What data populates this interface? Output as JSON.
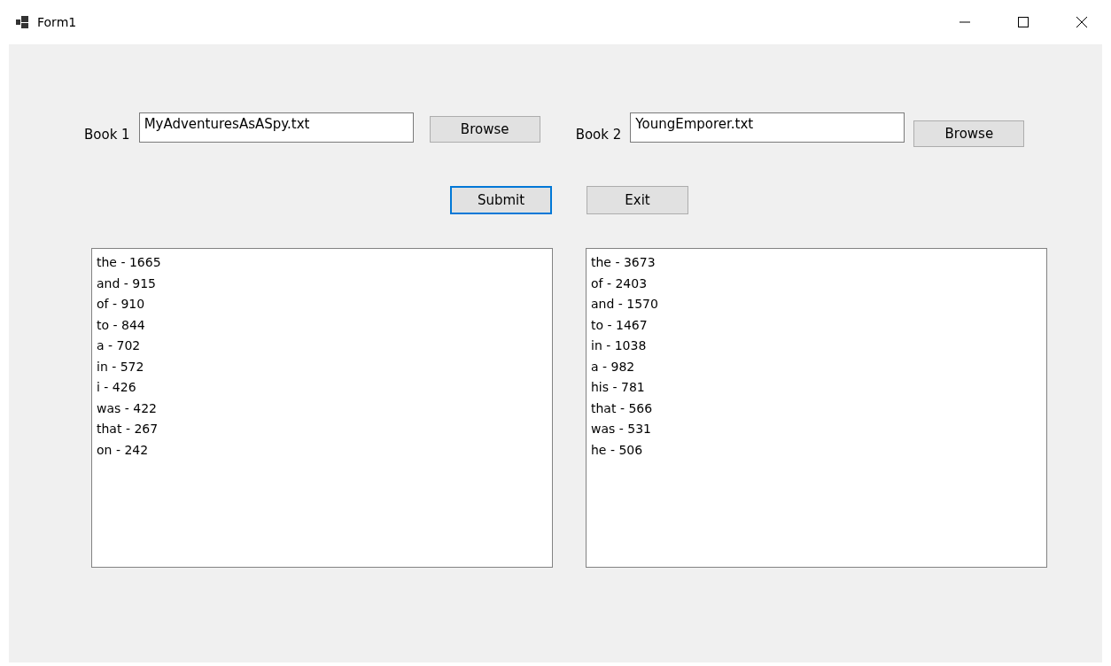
{
  "window": {
    "title": "Form1"
  },
  "books": [
    {
      "label": "Book 1",
      "value": "MyAdventuresAsASpy.txt",
      "button": "Browse"
    },
    {
      "label": "Book 2",
      "value": "YoungEmporer.txt",
      "button": "Browse"
    }
  ],
  "actions": [
    {
      "label": "Submit",
      "focused": true
    },
    {
      "label": "Exit",
      "focused": false
    }
  ],
  "lists": [
    {
      "items": [
        "the - 1665",
        "and - 915",
        "of - 910",
        "to - 844",
        "a - 702",
        "in - 572",
        "i - 426",
        "was - 422",
        "that - 267",
        "on - 242"
      ]
    },
    {
      "items": [
        "the - 3673",
        "of - 2403",
        "and - 1570",
        "to - 1467",
        "in - 1038",
        "a - 982",
        "his - 781",
        "that - 566",
        "was - 531",
        "he - 506"
      ]
    }
  ]
}
